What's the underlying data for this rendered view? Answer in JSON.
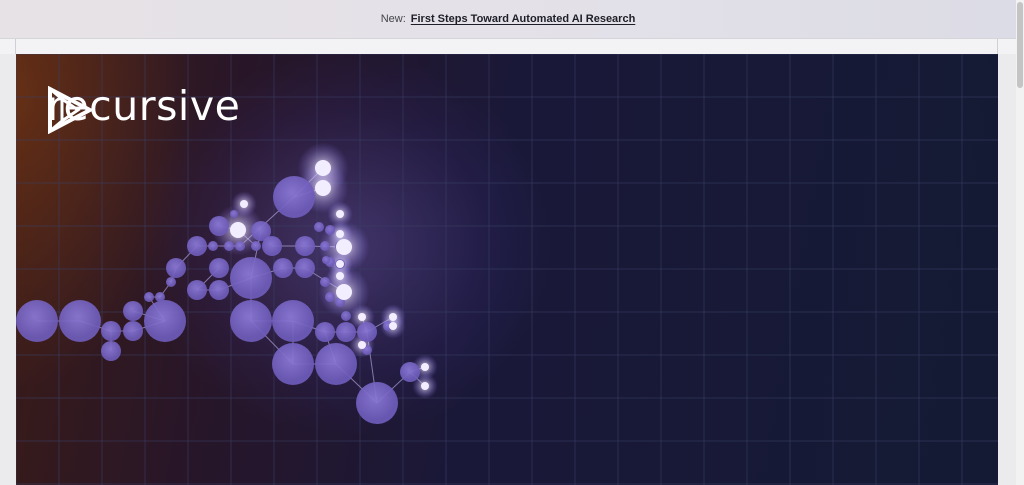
{
  "announcement": {
    "prefix": "New:",
    "link_text": "First Steps Toward Automated AI Research"
  },
  "brand": {
    "name": "recursive",
    "logo_icon": "play-triangle-logo-icon"
  },
  "colors": {
    "node": "#7a67c8",
    "node_bright": "#f3eeff",
    "grid": "#3a3f66",
    "hero_dark": "#141a34",
    "hero_warm": "#3c1c16"
  }
}
